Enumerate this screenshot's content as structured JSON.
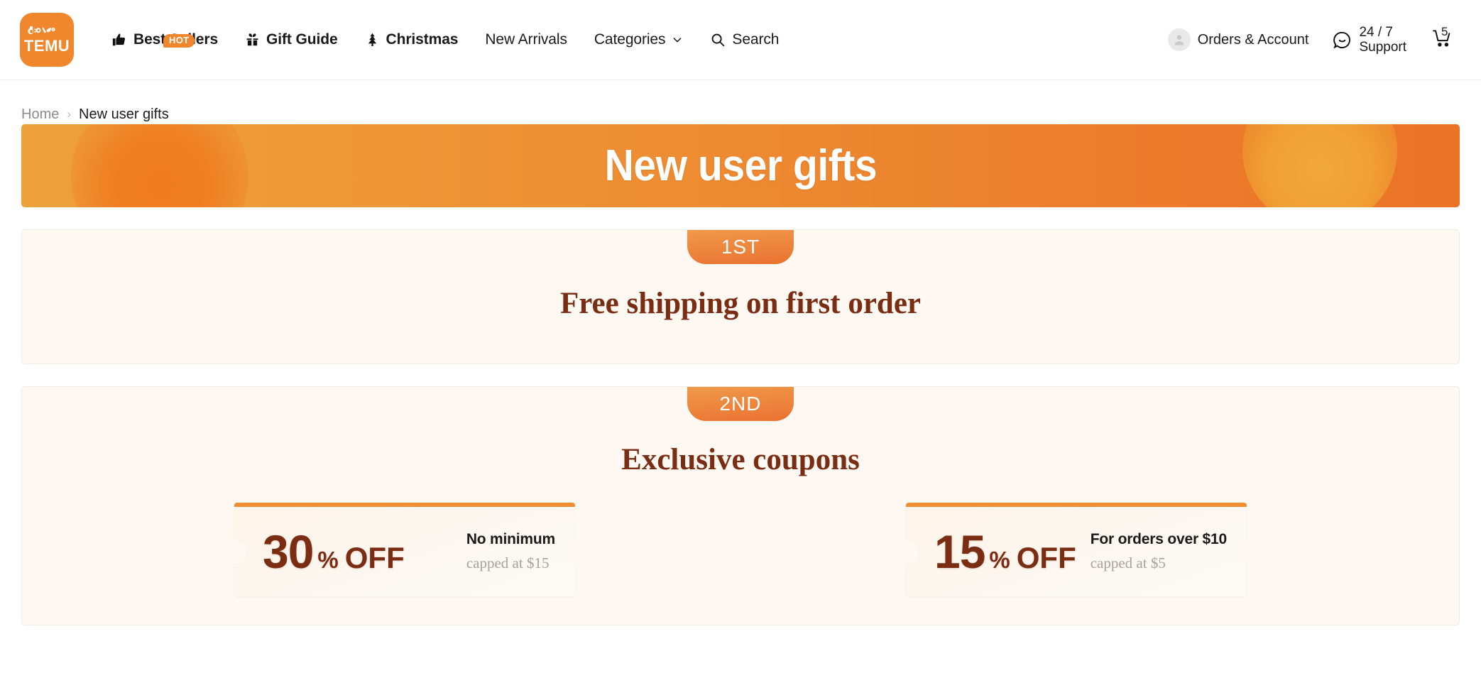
{
  "header": {
    "logo": {
      "word": "TEMU",
      "icon": "temu-logo-icon"
    },
    "nav": [
      {
        "label": "Best Sellers",
        "icon": "thumbs-up-icon",
        "badge": "HOT"
      },
      {
        "label": "Gift Guide",
        "icon": "gift-icon"
      },
      {
        "label": "Christmas",
        "icon": "christmas-tree-icon"
      },
      {
        "label": "New Arrivals",
        "icon": ""
      },
      {
        "label": "Categories",
        "icon": "chevron-down-icon"
      },
      {
        "label": "Search",
        "icon": "search-icon"
      }
    ],
    "account_label": "Orders & Account",
    "support_line1": "24 / 7",
    "support_line2": "Support",
    "cart_count": "5"
  },
  "breadcrumb": {
    "home": "Home",
    "separator": "›",
    "current": "New user gifts"
  },
  "banner": {
    "title": "New user gifts"
  },
  "sections": [
    {
      "badge": "1ST",
      "title": "Free shipping on first order"
    },
    {
      "badge": "2ND",
      "title": "Exclusive coupons"
    }
  ],
  "coupons": [
    {
      "amount": "30",
      "symbol": "%",
      "off": "OFF",
      "condition": "No minimum",
      "cap": "capped at $15"
    },
    {
      "amount": "15",
      "symbol": "%",
      "off": "OFF",
      "condition": "For orders over $10",
      "cap": "capped at $5"
    }
  ],
  "colors": {
    "brand_orange": "#f1872c",
    "banner_left": "#eda13a",
    "banner_right": "#ea7326",
    "heading_brown": "#7b2d14",
    "card_cream": "#fdf8f1"
  }
}
